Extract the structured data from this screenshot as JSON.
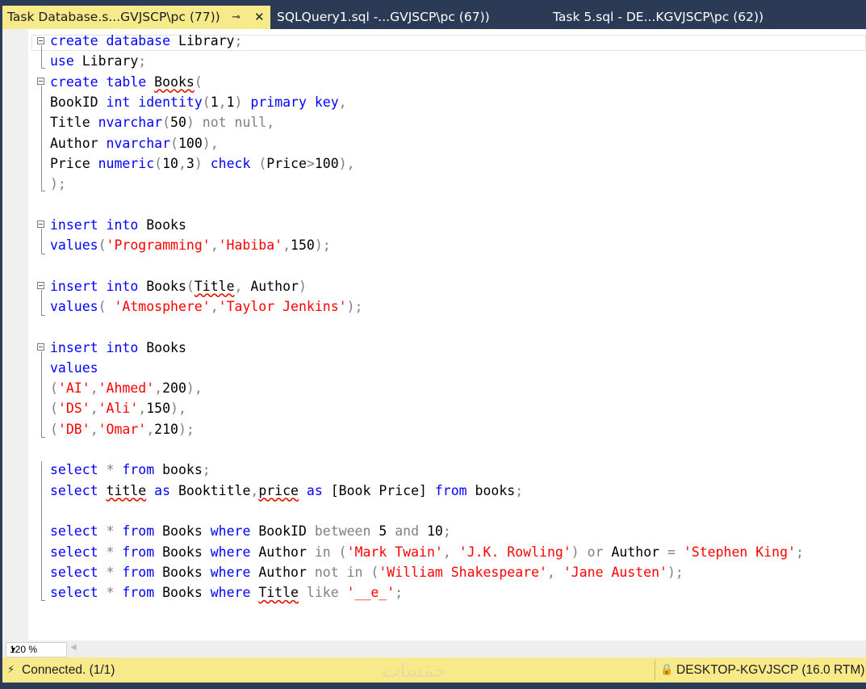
{
  "tabs": [
    {
      "label": "Task Database.s...GVJSCP\\pc (77))",
      "active": true
    },
    {
      "label": "SQLQuery1.sql -...GVJSCP\\pc (67))",
      "active": false
    },
    {
      "label": "Task 5.sql - DE...KGVJSCP\\pc (62))",
      "active": false
    }
  ],
  "icons": {
    "pin": "pin-icon",
    "close": "close-icon",
    "zoom_dropdown": "chevron-down-icon",
    "scroll_left": "scroll-left-arrow-icon",
    "connected": "connection-plug-icon",
    "server": "lock-icon"
  },
  "editor": {
    "lines": [
      [
        [
          "kw",
          "create database "
        ],
        [
          "t",
          "Library"
        ],
        [
          "op",
          ";"
        ]
      ],
      [
        [
          "kw",
          "use "
        ],
        [
          "t",
          "Library"
        ],
        [
          "op",
          ";"
        ]
      ],
      [
        [
          "kw",
          "create table "
        ],
        [
          "sq",
          "Books"
        ],
        [
          "op",
          "("
        ]
      ],
      [
        [
          "t",
          "BookID "
        ],
        [
          "kw",
          "int identity"
        ],
        [
          "op",
          "("
        ],
        [
          "t",
          "1"
        ],
        [
          "op",
          ","
        ],
        [
          "t",
          "1"
        ],
        [
          "op",
          ") "
        ],
        [
          "kw",
          "primary key"
        ],
        [
          "op",
          ","
        ]
      ],
      [
        [
          "t",
          "Title "
        ],
        [
          "kw",
          "nvarchar"
        ],
        [
          "op",
          "("
        ],
        [
          "t",
          "50"
        ],
        [
          "op",
          ") not null,"
        ]
      ],
      [
        [
          "t",
          "Author "
        ],
        [
          "kw",
          "nvarchar"
        ],
        [
          "op",
          "("
        ],
        [
          "t",
          "100"
        ],
        [
          "op",
          "),"
        ]
      ],
      [
        [
          "t",
          "Price "
        ],
        [
          "kw",
          "numeric"
        ],
        [
          "op",
          "("
        ],
        [
          "t",
          "10"
        ],
        [
          "op",
          ","
        ],
        [
          "t",
          "3"
        ],
        [
          "op",
          ") "
        ],
        [
          "kw",
          "check "
        ],
        [
          "op",
          "("
        ],
        [
          "t",
          "Price"
        ],
        [
          "op",
          ">"
        ],
        [
          "t",
          "100"
        ],
        [
          "op",
          "),"
        ]
      ],
      [
        [
          "op",
          ");"
        ]
      ],
      [],
      [
        [
          "kw",
          "insert into "
        ],
        [
          "t",
          "Books"
        ]
      ],
      [
        [
          "kw",
          "values"
        ],
        [
          "op",
          "("
        ],
        [
          "str",
          "'Programming'"
        ],
        [
          "op",
          ","
        ],
        [
          "str",
          "'Habiba'"
        ],
        [
          "op",
          ","
        ],
        [
          "t",
          "150"
        ],
        [
          "op",
          ");"
        ]
      ],
      [],
      [
        [
          "kw",
          "insert into "
        ],
        [
          "t",
          "Books"
        ],
        [
          "op",
          "("
        ],
        [
          "sq",
          "Title"
        ],
        [
          "op",
          ", "
        ],
        [
          "t",
          "Author"
        ],
        [
          "op",
          ")"
        ]
      ],
      [
        [
          "kw",
          "values"
        ],
        [
          "op",
          "( "
        ],
        [
          "str",
          "'Atmosphere'"
        ],
        [
          "op",
          ","
        ],
        [
          "str",
          "'Taylor Jenkins'"
        ],
        [
          "op",
          ");"
        ]
      ],
      [],
      [
        [
          "kw",
          "insert into "
        ],
        [
          "t",
          "Books"
        ]
      ],
      [
        [
          "kw",
          "values"
        ]
      ],
      [
        [
          "op",
          "("
        ],
        [
          "str",
          "'AI'"
        ],
        [
          "op",
          ","
        ],
        [
          "str",
          "'Ahmed'"
        ],
        [
          "op",
          ","
        ],
        [
          "t",
          "200"
        ],
        [
          "op",
          "),"
        ]
      ],
      [
        [
          "op",
          "("
        ],
        [
          "str",
          "'DS'"
        ],
        [
          "op",
          ","
        ],
        [
          "str",
          "'Ali'"
        ],
        [
          "op",
          ","
        ],
        [
          "t",
          "150"
        ],
        [
          "op",
          "),"
        ]
      ],
      [
        [
          "op",
          "("
        ],
        [
          "str",
          "'DB'"
        ],
        [
          "op",
          ","
        ],
        [
          "str",
          "'Omar'"
        ],
        [
          "op",
          ","
        ],
        [
          "t",
          "210"
        ],
        [
          "op",
          ");"
        ]
      ],
      [],
      [
        [
          "kw",
          "select "
        ],
        [
          "op",
          "* "
        ],
        [
          "kw",
          "from "
        ],
        [
          "t",
          "books"
        ],
        [
          "op",
          ";"
        ]
      ],
      [
        [
          "kw",
          "select "
        ],
        [
          "sq",
          "title"
        ],
        [
          "kw",
          " as "
        ],
        [
          "t",
          "Booktitle"
        ],
        [
          "op",
          ","
        ],
        [
          "sq",
          "price"
        ],
        [
          "kw",
          " as "
        ],
        [
          "t",
          "[Book Price] "
        ],
        [
          "kw",
          "from "
        ],
        [
          "t",
          "books"
        ],
        [
          "op",
          ";"
        ]
      ],
      [],
      [
        [
          "kw",
          "select "
        ],
        [
          "op",
          "* "
        ],
        [
          "kw",
          "from "
        ],
        [
          "t",
          "Books "
        ],
        [
          "kw",
          "where "
        ],
        [
          "t",
          "BookID "
        ],
        [
          "op",
          "between "
        ],
        [
          "t",
          "5 "
        ],
        [
          "op",
          "and "
        ],
        [
          "t",
          "10"
        ],
        [
          "op",
          ";"
        ]
      ],
      [
        [
          "kw",
          "select "
        ],
        [
          "op",
          "* "
        ],
        [
          "kw",
          "from "
        ],
        [
          "t",
          "Books "
        ],
        [
          "kw",
          "where "
        ],
        [
          "t",
          "Author "
        ],
        [
          "op",
          "in ("
        ],
        [
          "str",
          "'Mark Twain'"
        ],
        [
          "op",
          ", "
        ],
        [
          "str",
          "'J.K. Rowling'"
        ],
        [
          "op",
          ") or "
        ],
        [
          "t",
          "Author "
        ],
        [
          "op",
          "= "
        ],
        [
          "str",
          "'Stephen King'"
        ],
        [
          "op",
          ";"
        ]
      ],
      [
        [
          "kw",
          "select "
        ],
        [
          "op",
          "* "
        ],
        [
          "kw",
          "from "
        ],
        [
          "t",
          "Books "
        ],
        [
          "kw",
          "where "
        ],
        [
          "t",
          "Author "
        ],
        [
          "op",
          "not in ("
        ],
        [
          "str",
          "'William Shakespeare'"
        ],
        [
          "op",
          ", "
        ],
        [
          "str",
          "'Jane Austen'"
        ],
        [
          "op",
          ");"
        ]
      ],
      [
        [
          "kw",
          "select "
        ],
        [
          "op",
          "* "
        ],
        [
          "kw",
          "from "
        ],
        [
          "t",
          "Books "
        ],
        [
          "kw",
          "where "
        ],
        [
          "sq",
          "Title"
        ],
        [
          "op",
          " like "
        ],
        [
          "str",
          "'__e_'"
        ],
        [
          "op",
          ";"
        ]
      ]
    ]
  },
  "zoom": {
    "value": "120 %"
  },
  "status": {
    "connection": "Connected. (1/1)",
    "server": "DESKTOP-KGVJSCP (16.0 RTM)",
    "watermark": "خمسات"
  }
}
